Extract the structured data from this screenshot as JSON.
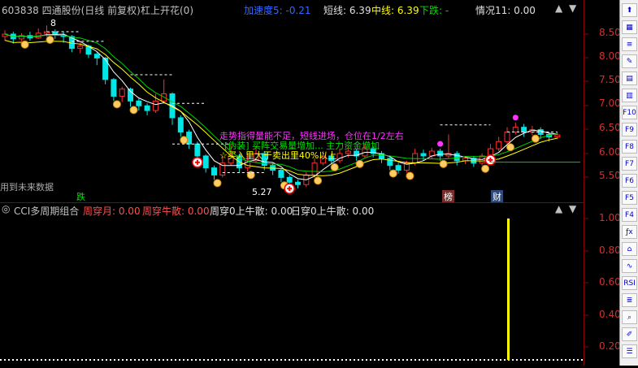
{
  "header": {
    "stock": "603838 四通股份(日线 前复权)",
    "indicator_name": "杠上开花(0)",
    "accel": "加速度5: -0.21",
    "short_line": "短线: 6.39",
    "mid_line": "中线: 6.39",
    "down_trend": "下跌: -",
    "situation": "情况11: 0.00"
  },
  "chart_annotations": {
    "future_data": "用到未来数据",
    "line1": "走势指得量能不足，短线进场，仓位在1/2左右",
    "line2": "[伪装] 买阵交易量增加... 主力资金增加",
    "line3": "☆买入里大于卖出里40%以上",
    "top_label": "8",
    "low_label": "5.27",
    "tag_drop": "跌",
    "tag_list": "榜",
    "tag_fin": "财"
  },
  "price_axis": [
    "8.50",
    "8.00",
    "7.50",
    "7.00",
    "6.50",
    "6.00",
    "5.50"
  ],
  "sub_header": {
    "name": "CCI多周期组合",
    "cross_month": "周穿月: 0.00",
    "week_bull": "周穿牛散: 0.00",
    "week_zero": "周穿0上牛散: 0.00",
    "day_zero": "日穿0上牛散: 0.00"
  },
  "sub_axis": [
    "1.00",
    "0.80",
    "0.60",
    "0.40",
    "0.20"
  ],
  "toolbar_items": [
    "⬆",
    "▦",
    "≡",
    "✎",
    "▤",
    "▥",
    "F10",
    "F9",
    "F8",
    "F7",
    "F6",
    "F5",
    "F4",
    "ƒx",
    "⌂",
    "∿",
    "RSI",
    "≣",
    "⌕",
    "✐",
    "☰"
  ],
  "colors": {
    "up": "#ff3030",
    "down": "#00e5e5",
    "ma": "#00d000",
    "accent": "#ffff00",
    "magenta": "#ff33ff"
  },
  "candles": [
    {
      "o": 8.45,
      "c": 8.5,
      "h": 8.58,
      "l": 8.36
    },
    {
      "o": 8.5,
      "c": 8.4,
      "h": 8.55,
      "l": 8.3
    },
    {
      "o": 8.4,
      "c": 8.47,
      "h": 8.52,
      "l": 8.35
    },
    {
      "o": 8.47,
      "c": 8.42,
      "h": 8.55,
      "l": 8.36
    },
    {
      "o": 8.42,
      "c": 8.52,
      "h": 8.62,
      "l": 8.4
    },
    {
      "o": 8.52,
      "c": 8.55,
      "h": 8.68,
      "l": 8.45
    },
    {
      "o": 8.55,
      "c": 8.48,
      "h": 8.6,
      "l": 8.4
    },
    {
      "o": 8.48,
      "c": 8.45,
      "h": 8.55,
      "l": 8.32
    },
    {
      "o": 8.45,
      "c": 8.2,
      "h": 8.48,
      "l": 8.12
    },
    {
      "o": 8.2,
      "c": 8.25,
      "h": 8.32,
      "l": 8.1
    },
    {
      "o": 8.25,
      "c": 8.08,
      "h": 8.28,
      "l": 8.0
    },
    {
      "o": 8.08,
      "c": 8.0,
      "h": 8.12,
      "l": 7.85
    },
    {
      "o": 8.0,
      "c": 7.55,
      "h": 8.02,
      "l": 7.45
    },
    {
      "o": 7.55,
      "c": 7.2,
      "h": 7.58,
      "l": 7.1
    },
    {
      "o": 7.2,
      "c": 7.35,
      "h": 7.4,
      "l": 7.08
    },
    {
      "o": 7.35,
      "c": 7.1,
      "h": 7.38,
      "l": 6.98
    },
    {
      "o": 7.1,
      "c": 7.0,
      "h": 7.15,
      "l": 6.9
    },
    {
      "o": 7.0,
      "c": 6.9,
      "h": 7.05,
      "l": 6.8
    },
    {
      "o": 6.9,
      "c": 7.1,
      "h": 7.25,
      "l": 6.85
    },
    {
      "o": 7.1,
      "c": 7.25,
      "h": 7.55,
      "l": 7.05
    },
    {
      "o": 7.25,
      "c": 6.75,
      "h": 7.28,
      "l": 6.6
    },
    {
      "o": 6.75,
      "c": 6.45,
      "h": 6.8,
      "l": 6.35
    },
    {
      "o": 6.45,
      "c": 6.2,
      "h": 6.5,
      "l": 6.1
    },
    {
      "o": 6.2,
      "c": 5.95,
      "h": 6.25,
      "l": 5.85
    },
    {
      "o": 5.95,
      "c": 5.7,
      "h": 5.98,
      "l": 5.6
    },
    {
      "o": 5.7,
      "c": 5.55,
      "h": 5.75,
      "l": 5.45
    },
    {
      "o": 5.55,
      "c": 5.8,
      "h": 5.95,
      "l": 5.5
    },
    {
      "o": 5.8,
      "c": 5.95,
      "h": 6.2,
      "l": 5.75
    },
    {
      "o": 5.95,
      "c": 5.7,
      "h": 6.0,
      "l": 5.6
    },
    {
      "o": 5.7,
      "c": 5.85,
      "h": 6.0,
      "l": 5.62
    },
    {
      "o": 5.85,
      "c": 6.0,
      "h": 6.15,
      "l": 5.8
    },
    {
      "o": 6.0,
      "c": 5.75,
      "h": 6.05,
      "l": 5.65
    },
    {
      "o": 5.75,
      "c": 5.65,
      "h": 5.8,
      "l": 5.55
    },
    {
      "o": 5.65,
      "c": 5.5,
      "h": 5.68,
      "l": 5.4
    },
    {
      "o": 5.5,
      "c": 5.4,
      "h": 5.55,
      "l": 5.3
    },
    {
      "o": 5.4,
      "c": 5.35,
      "h": 5.45,
      "l": 5.27
    },
    {
      "o": 5.35,
      "c": 5.55,
      "h": 5.62,
      "l": 5.3
    },
    {
      "o": 5.55,
      "c": 5.8,
      "h": 5.9,
      "l": 5.5
    },
    {
      "o": 5.8,
      "c": 5.95,
      "h": 6.05,
      "l": 5.75
    },
    {
      "o": 5.95,
      "c": 5.85,
      "h": 6.0,
      "l": 5.78
    },
    {
      "o": 5.85,
      "c": 6.0,
      "h": 6.1,
      "l": 5.8
    },
    {
      "o": 6.0,
      "c": 6.05,
      "h": 6.12,
      "l": 5.92
    },
    {
      "o": 6.05,
      "c": 5.95,
      "h": 6.1,
      "l": 5.85
    },
    {
      "o": 5.95,
      "c": 6.1,
      "h": 6.2,
      "l": 5.9
    },
    {
      "o": 6.1,
      "c": 6.0,
      "h": 6.15,
      "l": 5.92
    },
    {
      "o": 6.0,
      "c": 5.9,
      "h": 6.05,
      "l": 5.8
    },
    {
      "o": 5.9,
      "c": 5.75,
      "h": 5.95,
      "l": 5.65
    },
    {
      "o": 5.75,
      "c": 5.65,
      "h": 5.8,
      "l": 5.58
    },
    {
      "o": 5.65,
      "c": 5.8,
      "h": 5.85,
      "l": 5.6
    },
    {
      "o": 5.8,
      "c": 6.0,
      "h": 6.1,
      "l": 5.75
    },
    {
      "o": 6.0,
      "c": 5.95,
      "h": 6.08,
      "l": 5.85
    },
    {
      "o": 5.95,
      "c": 6.05,
      "h": 6.12,
      "l": 5.9
    },
    {
      "o": 6.05,
      "c": 5.95,
      "h": 6.1,
      "l": 5.85
    },
    {
      "o": 5.95,
      "c": 6.0,
      "h": 6.4,
      "l": 5.9
    },
    {
      "o": 6.0,
      "c": 5.85,
      "h": 6.05,
      "l": 5.75
    },
    {
      "o": 5.85,
      "c": 5.9,
      "h": 5.95,
      "l": 5.78
    },
    {
      "o": 5.9,
      "c": 5.8,
      "h": 5.95,
      "l": 5.72
    },
    {
      "o": 5.8,
      "c": 5.95,
      "h": 6.0,
      "l": 5.75
    },
    {
      "o": 5.95,
      "c": 6.1,
      "h": 6.2,
      "l": 5.9
    },
    {
      "o": 6.1,
      "c": 6.25,
      "h": 6.35,
      "l": 6.05
    },
    {
      "o": 6.25,
      "c": 6.45,
      "h": 6.55,
      "l": 6.2
    },
    {
      "o": 6.45,
      "c": 6.55,
      "h": 6.65,
      "l": 6.4
    },
    {
      "o": 6.55,
      "c": 6.45,
      "h": 6.62,
      "l": 6.35
    },
    {
      "o": 6.45,
      "c": 6.5,
      "h": 6.58,
      "l": 6.38
    },
    {
      "o": 6.5,
      "c": 6.4,
      "h": 6.55,
      "l": 6.3
    },
    {
      "o": 6.4,
      "c": 6.35,
      "h": 6.45,
      "l": 6.25
    },
    {
      "o": 6.35,
      "c": 6.39,
      "h": 6.45,
      "l": 6.3
    }
  ]
}
